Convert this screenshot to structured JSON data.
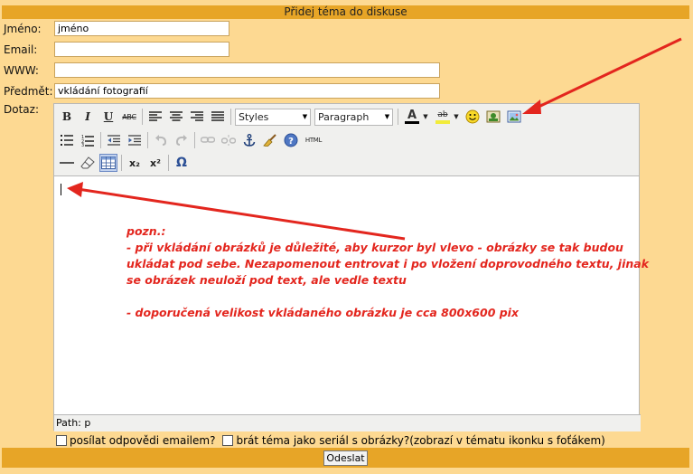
{
  "header": {
    "title": "Přidej téma do diskuse"
  },
  "form": {
    "name_label": "Jméno:",
    "name_value": "jméno",
    "email_label": "Email:",
    "email_value": "",
    "www_label": "WWW:",
    "www_value": "",
    "subject_label": "Předmět:",
    "subject_value": "vkládání fotografií",
    "question_label": "Dotaz:"
  },
  "editor": {
    "styles_value": "Styles",
    "paragraph_value": "Paragraph",
    "path_label": "Path: p",
    "toolbar": {
      "bold": "B",
      "italic": "I",
      "underline": "U",
      "strike": "ABC",
      "html": "HTML",
      "subscript": "x₂",
      "superscript": "x²",
      "omega": "Ω",
      "font_color": "A",
      "highlight": "ab"
    },
    "note_lines": [
      "pozn.:",
      "- při vkládání obrázků je důležité, aby kurzor byl vlevo - obrázky se tak budou",
      "ukládat pod sebe. Nezapomenout entrovat i po vložení doprovodného textu, jinak",
      "se obrázek neuloží pod text, ale vedle textu",
      "",
      "- doporučená velikost vkládaného obrázku je cca 800x600 pix"
    ]
  },
  "options": {
    "email_replies_label": "posílat odpovědi emailem?",
    "serial_label": "brát téma jako seriál s obrázky?(zobrazí v tématu ikonku s foťákem)"
  },
  "submit": {
    "label": "Odeslat"
  },
  "colors": {
    "background": "#fdd992",
    "header_bar": "#e7a527",
    "annotation_red": "#e3261e"
  }
}
